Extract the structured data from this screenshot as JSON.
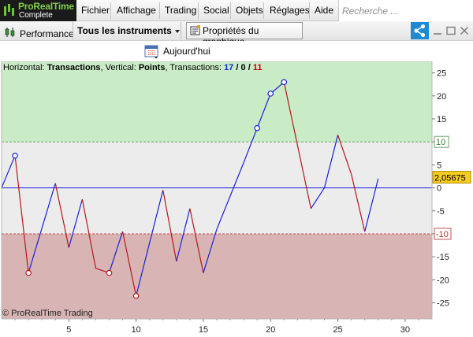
{
  "app": {
    "logo_name": "ProRealTime",
    "logo_sub": "Complete",
    "menu": [
      "Fichier",
      "Affichage",
      "Trading",
      "Social",
      "Objets",
      "Réglages",
      "Aide"
    ],
    "search_placeholder": "Recherche ..."
  },
  "toolbar": {
    "performance_label": "Performance",
    "instruments_label": "Tous les instruments",
    "properties_label": "Propriétés du graphique...",
    "share_icon": "share-icon",
    "colors": {
      "share_bg": "#1d8ad6"
    }
  },
  "datebar": {
    "label": "Aujourd'hui",
    "icon": "calendar-icon"
  },
  "chart_header": {
    "horizontal_label": "Horizontal:",
    "horizontal_value": "Transactions",
    "vertical_label": "Vertical:",
    "vertical_value": "Points",
    "transactions_label": "Transactions:",
    "count_total": "17",
    "count_mid": "0",
    "count_loss": "11",
    "sep": "/"
  },
  "watermark": "© ProRealTime Trading",
  "chart_data": {
    "type": "line",
    "xlim": [
      0,
      32
    ],
    "ylim": [
      -28.5,
      27.5
    ],
    "x_ticks": [
      5,
      10,
      15,
      20,
      25,
      30
    ],
    "y_ticks": [
      25,
      20,
      15,
      10,
      5,
      0,
      -5,
      -10,
      -15,
      -20,
      -25
    ],
    "x_tick_labels": [
      "5",
      "10",
      "15",
      "20",
      "25",
      "30"
    ],
    "y_tick_labels": [
      "25",
      "20",
      "15",
      "10",
      "5",
      "0",
      "-5",
      "-10",
      "-15",
      "-20",
      "-25"
    ],
    "upper_threshold": 10,
    "lower_threshold": -10,
    "upper_threshold_label": "10",
    "lower_threshold_label": "-10",
    "current_value": "2,05675",
    "zero_line": 0,
    "points": [
      {
        "x": 0,
        "y": 0
      },
      {
        "x": 1,
        "y": 7,
        "marker": true
      },
      {
        "x": 2,
        "y": -18.5,
        "marker": true
      },
      {
        "x": 4,
        "y": 1
      },
      {
        "x": 5,
        "y": -13
      },
      {
        "x": 6,
        "y": -2.5
      },
      {
        "x": 7,
        "y": -17.5
      },
      {
        "x": 8,
        "y": -18.5,
        "marker": true
      },
      {
        "x": 9,
        "y": -9.5
      },
      {
        "x": 10,
        "y": -23.5,
        "marker": true
      },
      {
        "x": 12,
        "y": -0.5
      },
      {
        "x": 13,
        "y": -16
      },
      {
        "x": 14,
        "y": -4.5
      },
      {
        "x": 15,
        "y": -18.5
      },
      {
        "x": 16,
        "y": -9
      },
      {
        "x": 18,
        "y": 5.5
      },
      {
        "x": 19,
        "y": 13,
        "marker": true
      },
      {
        "x": 20,
        "y": 20.5,
        "marker": true
      },
      {
        "x": 21,
        "y": 23,
        "marker": true
      },
      {
        "x": 23,
        "y": -4.5
      },
      {
        "x": 24,
        "y": 0
      },
      {
        "x": 25,
        "y": 11.5
      },
      {
        "x": 26,
        "y": 3
      },
      {
        "x": 27,
        "y": -9.5
      },
      {
        "x": 28,
        "y": 2
      }
    ],
    "colors": {
      "up": "#1a20d6",
      "down": "#b8161b",
      "zone_upper": "#c9ebc6",
      "zone_mid": "#ececec",
      "zone_lower": "#d8b5b4",
      "zero_line": "#1a20d6",
      "threshold_upper": "#6fa06a",
      "threshold_lower": "#c05050",
      "current_badge": "#f5cc1f"
    }
  }
}
